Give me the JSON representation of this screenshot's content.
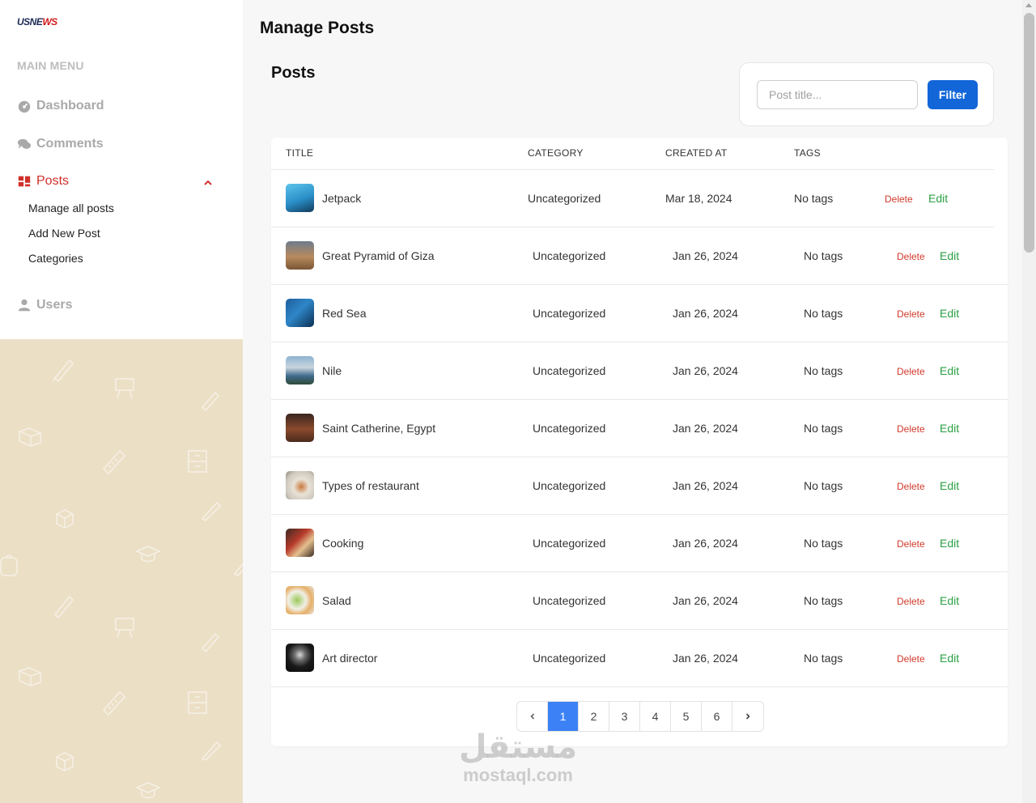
{
  "sidebar": {
    "logo_part1": "USNE",
    "logo_part2": "WS",
    "menu_heading": "MAIN MENU",
    "items": [
      {
        "label": "Dashboard"
      },
      {
        "label": "Comments"
      },
      {
        "label": "Posts"
      },
      {
        "label": "Users"
      }
    ],
    "posts_submenu": [
      "Manage all posts",
      "Add New Post",
      "Categories"
    ],
    "colors": {
      "active": "#d0302a",
      "pattern_bg": "#ebdfc6"
    }
  },
  "header": {
    "title": "Manage Posts",
    "section_title": "Posts"
  },
  "filter": {
    "placeholder": "Post title...",
    "value": "",
    "button_label": "Filter"
  },
  "table": {
    "columns": [
      "TITLE",
      "CATEGORY",
      "CREATED AT",
      "TAGS"
    ],
    "delete_label": "Delete",
    "edit_label": "Edit",
    "rows": [
      {
        "title": "Jetpack",
        "category": "Uncategorized",
        "created_at": "Mar 18, 2024",
        "tags": "No tags",
        "thumb": "sky-blue"
      },
      {
        "title": "Great Pyramid of Giza",
        "category": "Uncategorized",
        "created_at": "Jan 26, 2024",
        "tags": "No tags",
        "thumb": "desert"
      },
      {
        "title": "Red Sea",
        "category": "Uncategorized",
        "created_at": "Jan 26, 2024",
        "tags": "No tags",
        "thumb": "ocean"
      },
      {
        "title": "Nile",
        "category": "Uncategorized",
        "created_at": "Jan 26, 2024",
        "tags": "No tags",
        "thumb": "river"
      },
      {
        "title": "Saint Catherine, Egypt",
        "category": "Uncategorized",
        "created_at": "Jan 26, 2024",
        "tags": "No tags",
        "thumb": "mountain"
      },
      {
        "title": "Types of restaurant",
        "category": "Uncategorized",
        "created_at": "Jan 26, 2024",
        "tags": "No tags",
        "thumb": "plate"
      },
      {
        "title": "Cooking",
        "category": "Uncategorized",
        "created_at": "Jan 26, 2024",
        "tags": "No tags",
        "thumb": "kitchen"
      },
      {
        "title": "Salad",
        "category": "Uncategorized",
        "created_at": "Jan 26, 2024",
        "tags": "No tags",
        "thumb": "salad"
      },
      {
        "title": "Art director",
        "category": "Uncategorized",
        "created_at": "Jan 26, 2024",
        "tags": "No tags",
        "thumb": "portrait"
      }
    ]
  },
  "pagination": {
    "pages": [
      "1",
      "2",
      "3",
      "4",
      "5",
      "6"
    ],
    "current": 1
  },
  "watermark": {
    "arabic": "مستقل",
    "latin": "mostaql.com"
  }
}
